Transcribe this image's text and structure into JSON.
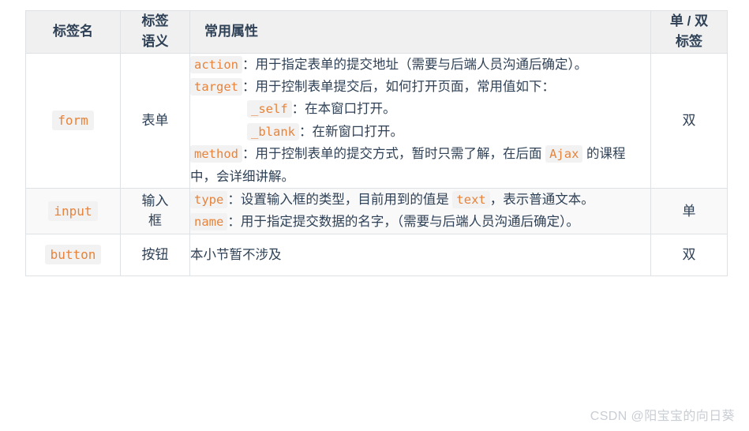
{
  "table": {
    "headers": {
      "tag_name": "标签名",
      "tag_semantic": "标签\n语义",
      "tag_semantic_line1": "标签",
      "tag_semantic_line2": "语义",
      "common_attributes": "常用属性",
      "pair_type_line1": "单 / 双",
      "pair_type_line2": "标签"
    },
    "rows": [
      {
        "tag": "form",
        "semantic": "表单",
        "pair": "双",
        "attributes": [
          {
            "indent": false,
            "parts": [
              {
                "type": "code",
                "text": "action"
              },
              {
                "type": "text",
                "text": "：用于指定表单的提交地址（需要与后端人员沟通后确定）。"
              }
            ]
          },
          {
            "indent": false,
            "parts": [
              {
                "type": "code",
                "text": "target"
              },
              {
                "type": "text",
                "text": "：用于控制表单提交后，如何打开页面，常用值如下："
              }
            ]
          },
          {
            "indent": true,
            "parts": [
              {
                "type": "code",
                "text": "_self"
              },
              {
                "type": "text",
                "text": "：在本窗口打开。"
              }
            ]
          },
          {
            "indent": true,
            "parts": [
              {
                "type": "code",
                "text": "_blank"
              },
              {
                "type": "text",
                "text": "：在新窗口打开。"
              }
            ]
          },
          {
            "indent": false,
            "parts": [
              {
                "type": "code",
                "text": "method"
              },
              {
                "type": "text",
                "text": "：用于控制表单的提交方式，暂时只需了解，在后面 "
              },
              {
                "type": "code",
                "text": "Ajax"
              },
              {
                "type": "text",
                "text": " 的课程中，会详细讲解。"
              }
            ]
          }
        ]
      },
      {
        "tag": "input",
        "semantic": "输入\n框",
        "semantic_line1": "输入",
        "semantic_line2": "框",
        "pair": "单",
        "attributes": [
          {
            "indent": false,
            "parts": [
              {
                "type": "code",
                "text": "type"
              },
              {
                "type": "text",
                "text": "：设置输入框的类型，目前用到的值是 "
              },
              {
                "type": "code",
                "text": "text"
              },
              {
                "type": "text",
                "text": "，表示普通文本。"
              }
            ]
          },
          {
            "indent": false,
            "parts": [
              {
                "type": "code",
                "text": "name"
              },
              {
                "type": "text",
                "text": "：用于指定提交数据的名字，（需要与后端人员沟通后确定）。"
              }
            ]
          }
        ]
      },
      {
        "tag": "button",
        "semantic": "按钮",
        "pair": "双",
        "attributes": [
          {
            "indent": false,
            "parts": [
              {
                "type": "text",
                "text": "本小节暂不涉及"
              }
            ]
          }
        ]
      }
    ]
  },
  "watermark": {
    "text": "CSDN @阳宝宝的向日葵"
  },
  "colors": {
    "code_text": "#e8833a",
    "code_background": "#f2f2f2",
    "body_text": "#2f4156",
    "header_background": "#f0f0f0",
    "border": "#dfe2e5",
    "alt_row_background": "#f9f9f9",
    "watermark": "#c9ced4"
  }
}
